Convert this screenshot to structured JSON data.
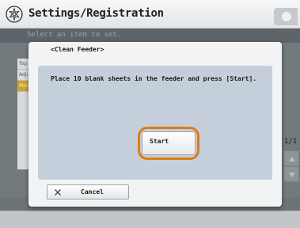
{
  "header": {
    "title": "Settings/Registration",
    "subtitle": "Select an item to set."
  },
  "list": {
    "items": [
      {
        "label": "Top",
        "selected": false
      },
      {
        "label": "Adjus",
        "selected": false
      },
      {
        "label": "Main",
        "selected": true
      }
    ]
  },
  "pager": {
    "page_indicator": "1/1"
  },
  "dialog": {
    "title": "<Clean Feeder>",
    "message": "Place 10 blank sheets in the feeder and press [Start].",
    "start_label": "Start",
    "cancel_label": "Cancel",
    "highlight_color": "#e07b14"
  },
  "icons": {
    "title_icon": "settings-gear-icon",
    "cancel_icon": "close-icon",
    "scroll_up": "arrow-up-icon",
    "scroll_down": "arrow-down-icon"
  }
}
